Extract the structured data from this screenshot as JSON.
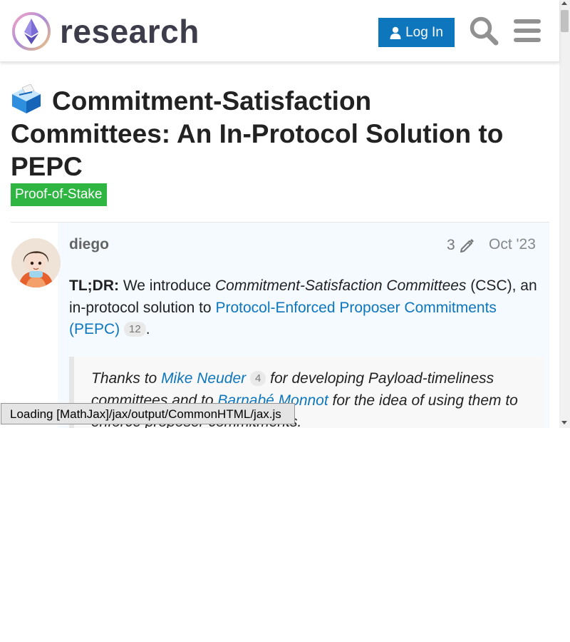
{
  "header": {
    "logo_text": "research",
    "login_label": "Log In"
  },
  "topic": {
    "title": "Commitment-Satisfaction Committees: An In-Protocol Solution to PEPC",
    "category": "Proof-of-Stake"
  },
  "post": {
    "username": "diego",
    "edit_count": "3",
    "date": "Oct '23",
    "tldr_label": "TL;DR:",
    "intro_text": " We introduce ",
    "csc_term": "Commitment-Satisfaction Committees",
    "middle_text": " (CSC), an in-protocol solution to ",
    "pepc_link": "Protocol-Enforced Proposer Commitments (PEPC)",
    "pepc_link_count": "12",
    "period": ".",
    "quote": {
      "prefix": "Thanks to ",
      "link1": "Mike Neuder",
      "link1_count": "4",
      "middle": " for developing Payload-timeliness committees and to ",
      "link2": "Barnabé Monnot",
      "suffix": " for the idea of using them to enforce proposer commitments."
    }
  },
  "status": {
    "mathjax_loading": "Loading [MathJax]/jax/output/CommonHTML/jax.js"
  },
  "colors": {
    "brand_blue": "#0e76bd",
    "category_green": "#2fb542",
    "post_bg": "#f4faff"
  }
}
